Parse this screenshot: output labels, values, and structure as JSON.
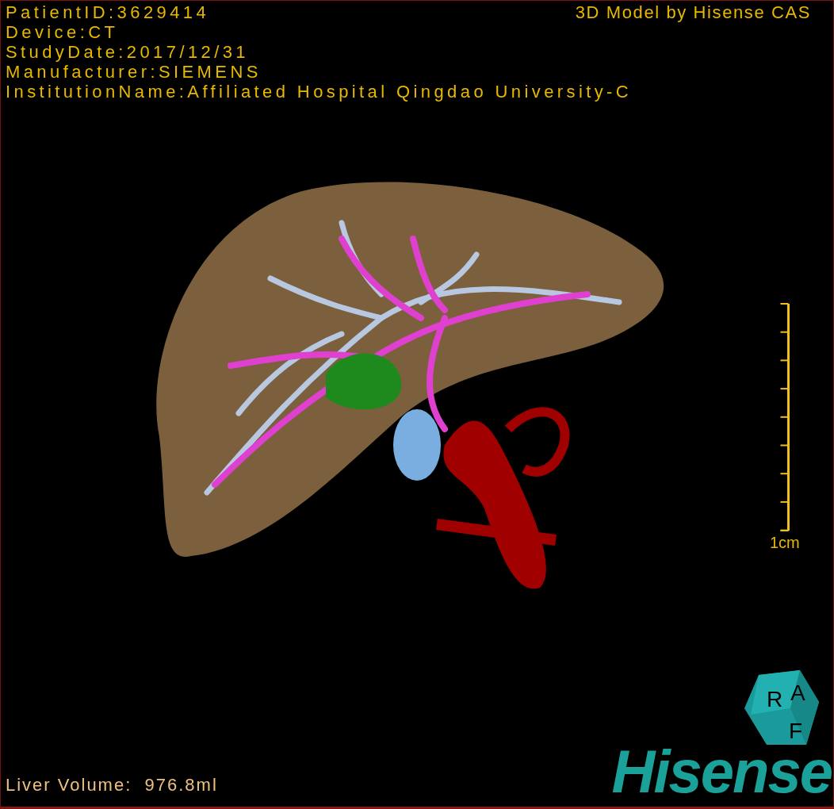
{
  "info_lines": [
    "PatientID:3629414",
    "Device:CT",
    "StudyDate:2017/12/31",
    "Manufacturer:SIEMENS",
    "InstitutionName:Affiliated Hospital Qingdao University-C"
  ],
  "title": "3D Model by Hisense CAS",
  "scale_bar": {
    "label": "1cm"
  },
  "orientation_cube": {
    "labels": [
      "R",
      "A",
      "F"
    ]
  },
  "logo": "Hisense",
  "liver_volume": "Liver Volume:  976.8ml"
}
